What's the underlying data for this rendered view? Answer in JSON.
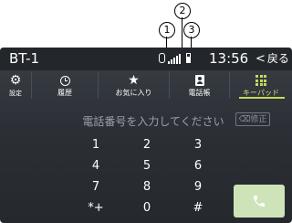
{
  "callouts": [
    "1",
    "2",
    "3"
  ],
  "status_bar": {
    "source": "BT-1",
    "clock": "13:56",
    "back_label": "戻る",
    "back_chevron": "<",
    "icons": [
      "bluetooth-icon",
      "signal-strength-icon",
      "battery-icon"
    ]
  },
  "tabs": [
    {
      "label": "設定",
      "icon": "gear-icon",
      "active": false
    },
    {
      "label": "履歴",
      "icon": "clock-icon",
      "active": false
    },
    {
      "label": "お気に入り",
      "icon": "star-icon",
      "active": false
    },
    {
      "label": "電話帳",
      "icon": "contact-icon",
      "active": false
    },
    {
      "label": "キーパッド",
      "icon": "keypad-icon",
      "active": true
    }
  ],
  "number_entry": {
    "placeholder": "電話番号を入力してください",
    "correct_label": "修正"
  },
  "keys": [
    "1",
    "2",
    "3",
    "4",
    "5",
    "6",
    "7",
    "8",
    "9",
    "*+",
    "0",
    "#"
  ],
  "call_button": {
    "icon": "phone-icon"
  },
  "colors": {
    "accent": "#c6d85a",
    "call_button": "#cfe3b9",
    "background": "#2c3036"
  }
}
